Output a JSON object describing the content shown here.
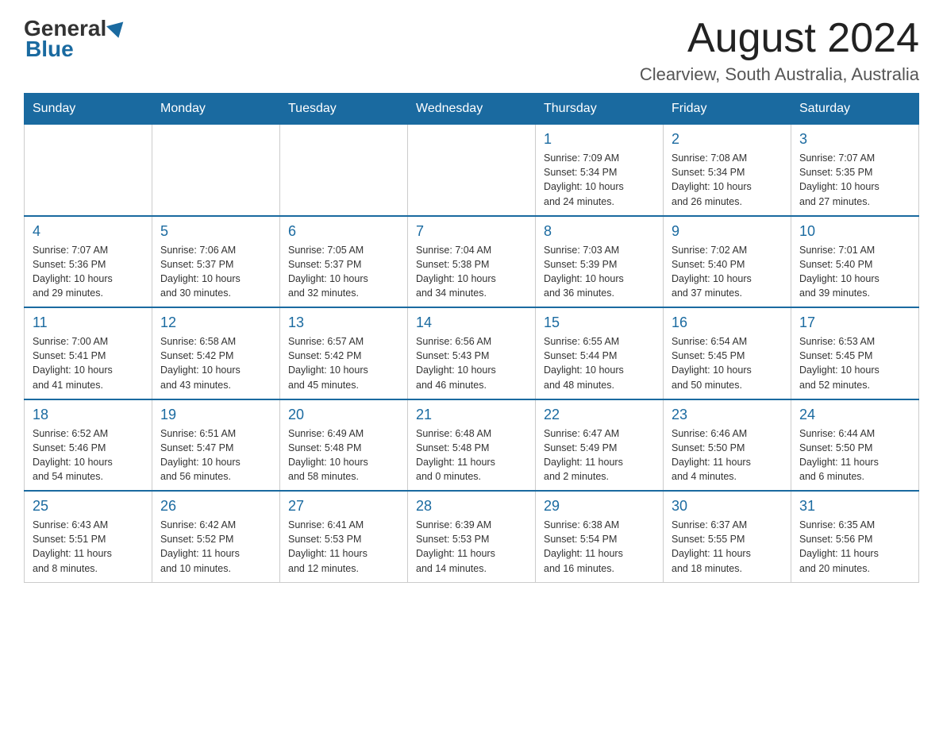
{
  "header": {
    "logo_general": "General",
    "logo_blue": "Blue",
    "month_title": "August 2024",
    "location": "Clearview, South Australia, Australia"
  },
  "days_of_week": [
    "Sunday",
    "Monday",
    "Tuesday",
    "Wednesday",
    "Thursday",
    "Friday",
    "Saturday"
  ],
  "weeks": [
    [
      {
        "day": "",
        "info": ""
      },
      {
        "day": "",
        "info": ""
      },
      {
        "day": "",
        "info": ""
      },
      {
        "day": "",
        "info": ""
      },
      {
        "day": "1",
        "info": "Sunrise: 7:09 AM\nSunset: 5:34 PM\nDaylight: 10 hours\nand 24 minutes."
      },
      {
        "day": "2",
        "info": "Sunrise: 7:08 AM\nSunset: 5:34 PM\nDaylight: 10 hours\nand 26 minutes."
      },
      {
        "day": "3",
        "info": "Sunrise: 7:07 AM\nSunset: 5:35 PM\nDaylight: 10 hours\nand 27 minutes."
      }
    ],
    [
      {
        "day": "4",
        "info": "Sunrise: 7:07 AM\nSunset: 5:36 PM\nDaylight: 10 hours\nand 29 minutes."
      },
      {
        "day": "5",
        "info": "Sunrise: 7:06 AM\nSunset: 5:37 PM\nDaylight: 10 hours\nand 30 minutes."
      },
      {
        "day": "6",
        "info": "Sunrise: 7:05 AM\nSunset: 5:37 PM\nDaylight: 10 hours\nand 32 minutes."
      },
      {
        "day": "7",
        "info": "Sunrise: 7:04 AM\nSunset: 5:38 PM\nDaylight: 10 hours\nand 34 minutes."
      },
      {
        "day": "8",
        "info": "Sunrise: 7:03 AM\nSunset: 5:39 PM\nDaylight: 10 hours\nand 36 minutes."
      },
      {
        "day": "9",
        "info": "Sunrise: 7:02 AM\nSunset: 5:40 PM\nDaylight: 10 hours\nand 37 minutes."
      },
      {
        "day": "10",
        "info": "Sunrise: 7:01 AM\nSunset: 5:40 PM\nDaylight: 10 hours\nand 39 minutes."
      }
    ],
    [
      {
        "day": "11",
        "info": "Sunrise: 7:00 AM\nSunset: 5:41 PM\nDaylight: 10 hours\nand 41 minutes."
      },
      {
        "day": "12",
        "info": "Sunrise: 6:58 AM\nSunset: 5:42 PM\nDaylight: 10 hours\nand 43 minutes."
      },
      {
        "day": "13",
        "info": "Sunrise: 6:57 AM\nSunset: 5:42 PM\nDaylight: 10 hours\nand 45 minutes."
      },
      {
        "day": "14",
        "info": "Sunrise: 6:56 AM\nSunset: 5:43 PM\nDaylight: 10 hours\nand 46 minutes."
      },
      {
        "day": "15",
        "info": "Sunrise: 6:55 AM\nSunset: 5:44 PM\nDaylight: 10 hours\nand 48 minutes."
      },
      {
        "day": "16",
        "info": "Sunrise: 6:54 AM\nSunset: 5:45 PM\nDaylight: 10 hours\nand 50 minutes."
      },
      {
        "day": "17",
        "info": "Sunrise: 6:53 AM\nSunset: 5:45 PM\nDaylight: 10 hours\nand 52 minutes."
      }
    ],
    [
      {
        "day": "18",
        "info": "Sunrise: 6:52 AM\nSunset: 5:46 PM\nDaylight: 10 hours\nand 54 minutes."
      },
      {
        "day": "19",
        "info": "Sunrise: 6:51 AM\nSunset: 5:47 PM\nDaylight: 10 hours\nand 56 minutes."
      },
      {
        "day": "20",
        "info": "Sunrise: 6:49 AM\nSunset: 5:48 PM\nDaylight: 10 hours\nand 58 minutes."
      },
      {
        "day": "21",
        "info": "Sunrise: 6:48 AM\nSunset: 5:48 PM\nDaylight: 11 hours\nand 0 minutes."
      },
      {
        "day": "22",
        "info": "Sunrise: 6:47 AM\nSunset: 5:49 PM\nDaylight: 11 hours\nand 2 minutes."
      },
      {
        "day": "23",
        "info": "Sunrise: 6:46 AM\nSunset: 5:50 PM\nDaylight: 11 hours\nand 4 minutes."
      },
      {
        "day": "24",
        "info": "Sunrise: 6:44 AM\nSunset: 5:50 PM\nDaylight: 11 hours\nand 6 minutes."
      }
    ],
    [
      {
        "day": "25",
        "info": "Sunrise: 6:43 AM\nSunset: 5:51 PM\nDaylight: 11 hours\nand 8 minutes."
      },
      {
        "day": "26",
        "info": "Sunrise: 6:42 AM\nSunset: 5:52 PM\nDaylight: 11 hours\nand 10 minutes."
      },
      {
        "day": "27",
        "info": "Sunrise: 6:41 AM\nSunset: 5:53 PM\nDaylight: 11 hours\nand 12 minutes."
      },
      {
        "day": "28",
        "info": "Sunrise: 6:39 AM\nSunset: 5:53 PM\nDaylight: 11 hours\nand 14 minutes."
      },
      {
        "day": "29",
        "info": "Sunrise: 6:38 AM\nSunset: 5:54 PM\nDaylight: 11 hours\nand 16 minutes."
      },
      {
        "day": "30",
        "info": "Sunrise: 6:37 AM\nSunset: 5:55 PM\nDaylight: 11 hours\nand 18 minutes."
      },
      {
        "day": "31",
        "info": "Sunrise: 6:35 AM\nSunset: 5:56 PM\nDaylight: 11 hours\nand 20 minutes."
      }
    ]
  ]
}
